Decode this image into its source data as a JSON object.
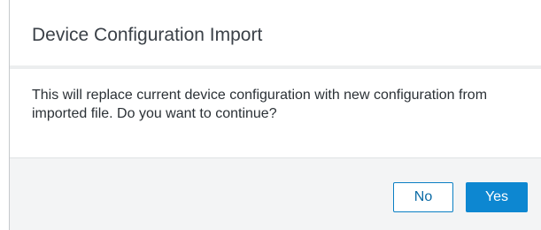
{
  "dialog": {
    "title": "Device Configuration Import",
    "message": "This will replace current device configuration with new configuration from imported file. Do you want to continue?",
    "buttons": {
      "no_label": "No",
      "yes_label": "Yes"
    }
  },
  "colors": {
    "primary": "#0d87d1",
    "footer_background": "#f3f4f5",
    "title_text": "#3b4148"
  }
}
